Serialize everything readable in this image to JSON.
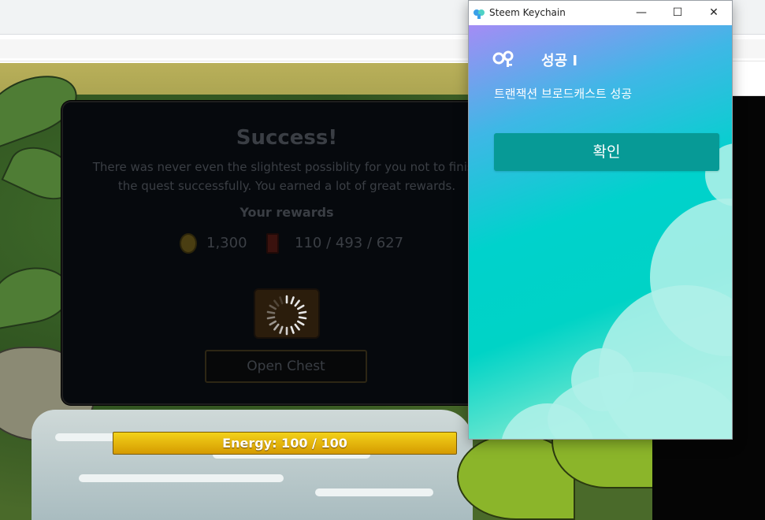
{
  "keychain": {
    "window_title": "Steem Keychain",
    "heading": "성공 I",
    "message": "트랜잭션 브로드캐스트 성공",
    "confirm_label": "확인",
    "controls": {
      "minimize": "—",
      "maximize": "☐",
      "close": "✕"
    },
    "colors": {
      "gradient_top": "#a48cf5",
      "gradient_mid": "#00d2cc",
      "button": "#079a96"
    }
  },
  "quest_modal": {
    "title": "Success!",
    "description": "There was never even the slightest possiblity for you not to finish the quest successfully. You earned a lot of great rewards.",
    "rewards_heading": "Your rewards",
    "coins": "1,300",
    "cards": "110 / 493 / 627",
    "open_chest_label": "Open Chest"
  },
  "energy_bar": {
    "label": "Energy: 100 / 100",
    "current": 100,
    "max": 100,
    "color": "#f3d21a"
  }
}
